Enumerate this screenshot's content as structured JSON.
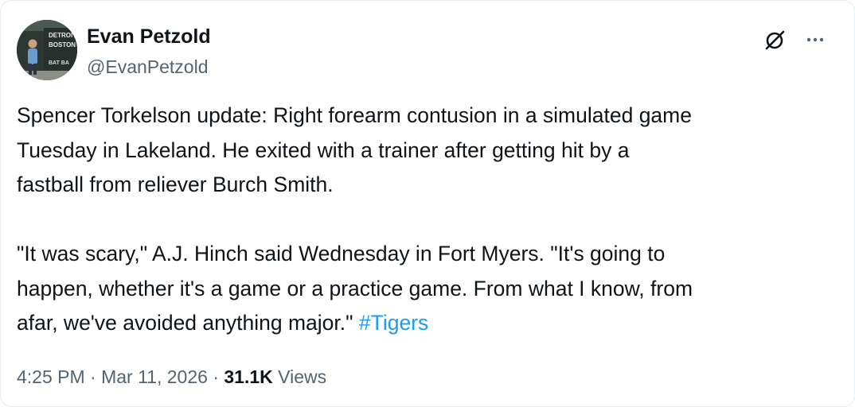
{
  "author": {
    "display_name": "Evan Petzold",
    "handle": "@EvanPetzold",
    "avatar_sign_lines": [
      "DETROIT",
      "BOSTON",
      "BAT BA"
    ]
  },
  "header_icons": {
    "grok": "grok-slash-circle-icon",
    "more": "more-dots-icon"
  },
  "tweet": {
    "body": "Spencer Torkelson update: Right forearm contusion in a simulated game\nTuesday in Lakeland. He exited with a trainer after getting hit by a\nfastball from reliever Burch Smith.\n\n\"It was scary,\" A.J. Hinch said Wednesday in Fort Myers. \"It's going to\nhappen, whether it's a game or a practice game. From what I know, from\nafar, we've avoided anything major.\" ",
    "hashtag": "#Tigers"
  },
  "meta": {
    "time": "4:25 PM",
    "separator1": " · ",
    "date": "Mar 11, 2026",
    "separator2": " · ",
    "views_count": "31.1K",
    "views_label": " Views"
  },
  "colors": {
    "text": "#0f1419",
    "secondary": "#536471",
    "link": "#1d9bf0"
  }
}
